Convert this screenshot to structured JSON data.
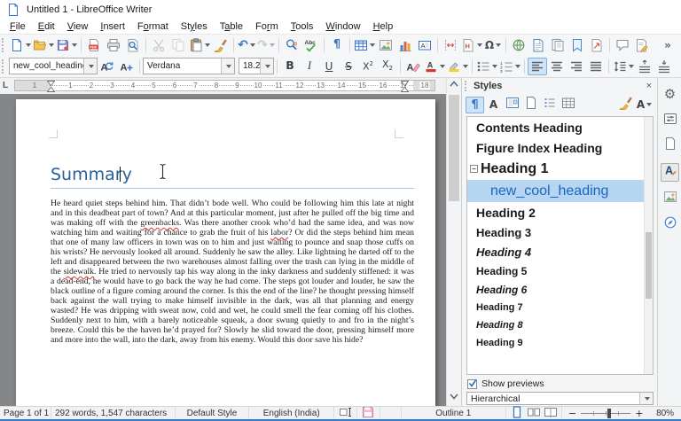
{
  "window": {
    "title": "Untitled 1 - LibreOffice Writer"
  },
  "menubar": {
    "items": [
      {
        "label": "File",
        "accel": 0
      },
      {
        "label": "Edit",
        "accel": 0
      },
      {
        "label": "View",
        "accel": 0
      },
      {
        "label": "Insert",
        "accel": 0
      },
      {
        "label": "Format",
        "accel": 1
      },
      {
        "label": "Styles",
        "accel": 2
      },
      {
        "label": "Table",
        "accel": 1
      },
      {
        "label": "Form",
        "accel": 2
      },
      {
        "label": "Tools",
        "accel": 0
      },
      {
        "label": "Window",
        "accel": 0
      },
      {
        "label": "Help",
        "accel": 0
      }
    ]
  },
  "toolbar_standard": {
    "buttons": [
      {
        "name": "new-document",
        "icon": "doc-new",
        "dropdown": true
      },
      {
        "name": "open",
        "icon": "folder-open",
        "dropdown": true
      },
      {
        "name": "save",
        "icon": "floppy",
        "dropdown": true
      },
      {
        "sep": true
      },
      {
        "name": "export-pdf",
        "icon": "pdf"
      },
      {
        "name": "print",
        "icon": "printer"
      },
      {
        "name": "print-preview",
        "icon": "print-preview"
      },
      {
        "sep": true
      },
      {
        "name": "cut",
        "icon": "scissors",
        "disabled": true
      },
      {
        "name": "copy",
        "icon": "copy-pages",
        "disabled": true
      },
      {
        "name": "paste",
        "icon": "clipboard-paste",
        "dropdown": true
      },
      {
        "name": "clone-formatting",
        "icon": "clone-brush"
      },
      {
        "sep": true
      },
      {
        "name": "undo",
        "icon": "undo-arrow",
        "dropdown": true
      },
      {
        "name": "redo",
        "icon": "redo-arrow",
        "dropdown": true,
        "disabled": true
      },
      {
        "sep": true
      },
      {
        "name": "find-and-replace",
        "icon": "find-replace"
      },
      {
        "name": "spelling",
        "icon": "spellcheck"
      },
      {
        "sep": true
      },
      {
        "name": "formatting-marks",
        "icon": "pilcrow"
      },
      {
        "sep": true
      },
      {
        "name": "insert-table",
        "icon": "table-grid",
        "dropdown": true
      },
      {
        "name": "insert-image",
        "icon": "picture"
      },
      {
        "name": "insert-chart",
        "icon": "bar-chart"
      },
      {
        "name": "insert-text-box",
        "icon": "text-box"
      },
      {
        "sep": true
      },
      {
        "name": "insert-page-break",
        "icon": "page-break"
      },
      {
        "name": "insert-field",
        "icon": "insert-field",
        "dropdown": true
      },
      {
        "name": "insert-special-character",
        "icon": "omega",
        "dropdown": true
      },
      {
        "sep": true
      },
      {
        "name": "insert-hyperlink",
        "icon": "globe-link"
      },
      {
        "name": "insert-footnote",
        "icon": "footnote-page"
      },
      {
        "name": "insert-endnote",
        "icon": "endnote-pages"
      },
      {
        "name": "insert-bookmark",
        "icon": "bookmark-page"
      },
      {
        "name": "insert-cross-reference",
        "icon": "cross-reference"
      },
      {
        "sep": true
      },
      {
        "name": "insert-comment",
        "icon": "comment-bubble"
      },
      {
        "name": "track-changes",
        "icon": "track-changes"
      },
      {
        "name": "toolbar-overflow",
        "icon": "chevron-double",
        "overflow": true
      }
    ]
  },
  "toolbar_formatting": {
    "paragraph_style": "new_cool_heading",
    "font_name": "Verdana",
    "font_size": "18.2",
    "buttons": [
      {
        "name": "bold",
        "icon": "bold"
      },
      {
        "name": "italic",
        "icon": "italic"
      },
      {
        "name": "underline",
        "icon": "underline"
      },
      {
        "name": "strikethrough",
        "icon": "strikethrough"
      },
      {
        "name": "superscript",
        "icon": "superscript"
      },
      {
        "name": "subscript",
        "icon": "subscript"
      },
      {
        "sep": true
      },
      {
        "name": "clear-formatting",
        "icon": "clear-format"
      },
      {
        "name": "font-color",
        "icon": "font-color",
        "dropdown": true
      },
      {
        "name": "highlighting-color",
        "icon": "highlight",
        "dropdown": true
      },
      {
        "sep": true
      },
      {
        "name": "unordered-list",
        "icon": "bullet-list",
        "dropdown": true
      },
      {
        "name": "ordered-list",
        "icon": "number-list",
        "dropdown": true
      },
      {
        "sep": true
      },
      {
        "name": "align-left",
        "icon": "align-left",
        "active": true
      },
      {
        "name": "align-center",
        "icon": "align-center"
      },
      {
        "name": "align-right",
        "icon": "align-right"
      },
      {
        "name": "justify",
        "icon": "align-justify"
      },
      {
        "sep": true
      },
      {
        "name": "line-spacing",
        "icon": "line-spacing",
        "dropdown": true
      },
      {
        "name": "increase-paragraph-spacing",
        "icon": "para-space-inc"
      },
      {
        "name": "decrease-paragraph-spacing",
        "icon": "para-space-dec"
      },
      {
        "name": "toolbar-overflow",
        "icon": "chevron-double",
        "overflow": true
      }
    ]
  },
  "ruler": {
    "margin_number": "1",
    "numbers": [
      "1",
      "2",
      "3",
      "4",
      "5",
      "6",
      "7",
      "8",
      "9",
      "10",
      "11",
      "12",
      "13",
      "14",
      "15",
      "16",
      "17",
      "18"
    ]
  },
  "document": {
    "heading_text": "Summary",
    "body_segments": [
      {
        "text": "He heard quiet steps behind him. That didn’t bode well. Who could be following him this late at night and in this deadbeat part of town? And at this particular moment, just after he pulled off the big time and was making off with the ",
        "misspelled": false
      },
      {
        "text": "greenbacks",
        "misspelled": true
      },
      {
        "text": ". Was there another crook who’d had the same idea, and was now watching him and waiting for a chance to grab the fruit of his ",
        "misspelled": false
      },
      {
        "text": "labor",
        "misspelled": true
      },
      {
        "text": "? Or did the steps behind him mean that one of many law officers in town was on to him and just waiting to pounce and snap those cuffs on his wrists? He nervously looked all around. Suddenly he saw the alley. Like lightning he darted off to the left and disappeared between the two warehouses almost falling over the trash can lying in the middle of the ",
        "misspelled": false
      },
      {
        "text": "sidewalk",
        "misspelled": true
      },
      {
        "text": ". He tried to nervously tap his way along in the inky darkness and suddenly stiffened: it was a dead-end, he would have to go back the way he had come. The steps got louder and louder, he saw the black outline of a figure coming around the corner. Is this the end of the line? he thought pressing himself back against the wall trying to make himself invisible in the dark, was all that planning and energy wasted? He was dripping with sweat now, cold and wet, he could smell the fear coming off his clothes. Suddenly next to him, with a barely noticeable squeak, a door swung quietly to and fro in the night’s breeze. Could this be the haven he’d prayed for? Slowly he slid toward the door, pressing himself more and more into the wall, into the dark, away from his enemy. Would this door save his hide?",
        "misspelled": false
      }
    ]
  },
  "styles_panel": {
    "title": "Styles",
    "close_label": "×",
    "category_tabs": [
      {
        "name": "paragraph-styles",
        "icon": "pilcrow",
        "active": true
      },
      {
        "name": "character-styles",
        "icon": "char-a"
      },
      {
        "name": "frame-styles",
        "icon": "frame"
      },
      {
        "name": "page-styles",
        "icon": "page"
      },
      {
        "name": "list-styles",
        "icon": "list-style"
      },
      {
        "name": "table-styles",
        "icon": "table-grid2"
      }
    ],
    "tools": [
      {
        "name": "fill-format-mode",
        "icon": "brush"
      },
      {
        "name": "style-actions",
        "icon": "char-a",
        "dropdown": true
      }
    ],
    "list": [
      {
        "label": "Contents Heading",
        "size": 14,
        "bold": true,
        "italic": false,
        "indent": 0,
        "selected": false,
        "expander": false
      },
      {
        "label": "Figure Index Heading",
        "size": 14,
        "bold": true,
        "italic": false,
        "indent": 0,
        "selected": false,
        "expander": false
      },
      {
        "label": "Heading 1",
        "size": 16,
        "bold": true,
        "italic": false,
        "indent": 0,
        "selected": false,
        "expander": true
      },
      {
        "label": "new_cool_heading",
        "size": 16,
        "bold": false,
        "italic": false,
        "indent": 1,
        "selected": true,
        "expander": false
      },
      {
        "label": "Heading 2",
        "size": 14,
        "bold": true,
        "italic": false,
        "indent": 0,
        "selected": false,
        "expander": false
      },
      {
        "label": "Heading 3",
        "size": 13,
        "bold": true,
        "italic": false,
        "indent": 0,
        "selected": false,
        "expander": false
      },
      {
        "label": "Heading 4",
        "size": 13,
        "bold": true,
        "italic": true,
        "indent": 0,
        "selected": false,
        "expander": false
      },
      {
        "label": "Heading 5",
        "size": 12,
        "bold": true,
        "italic": false,
        "indent": 0,
        "selected": false,
        "expander": false
      },
      {
        "label": "Heading 6",
        "size": 12,
        "bold": true,
        "italic": true,
        "indent": 0,
        "selected": false,
        "expander": false
      },
      {
        "label": "Heading 7",
        "size": 11,
        "bold": true,
        "italic": false,
        "indent": 0,
        "selected": false,
        "expander": false
      },
      {
        "label": "Heading 8",
        "size": 11,
        "bold": true,
        "italic": true,
        "indent": 0,
        "selected": false,
        "expander": false
      },
      {
        "label": "Heading 9",
        "size": 11,
        "bold": true,
        "italic": false,
        "indent": 0,
        "selected": false,
        "expander": false
      }
    ],
    "show_previews_label": "Show previews",
    "filter_value": "Hierarchical"
  },
  "sidebar_tabs": [
    {
      "name": "sidebar-settings",
      "icon": "gear"
    },
    {
      "name": "properties-deck",
      "icon": "sliders"
    },
    {
      "name": "page-deck",
      "icon": "page"
    },
    {
      "name": "styles-deck",
      "icon": "styles-a",
      "active": true
    },
    {
      "name": "gallery-deck",
      "icon": "picture"
    },
    {
      "name": "navigator-deck",
      "icon": "compass"
    }
  ],
  "status_bar": {
    "page": "Page 1 of 1",
    "words": "292 words, 1,547 characters",
    "style": "Default Style",
    "language": "English (India)",
    "outline": "Outline 1",
    "zoom": "80%"
  },
  "colors": {
    "accent": "#3478d6",
    "heading_blue": "#2a6099",
    "selection_bg": "#b5d5f1",
    "selection_text": "#1b66c0",
    "squiggly_red": "#e03030"
  }
}
